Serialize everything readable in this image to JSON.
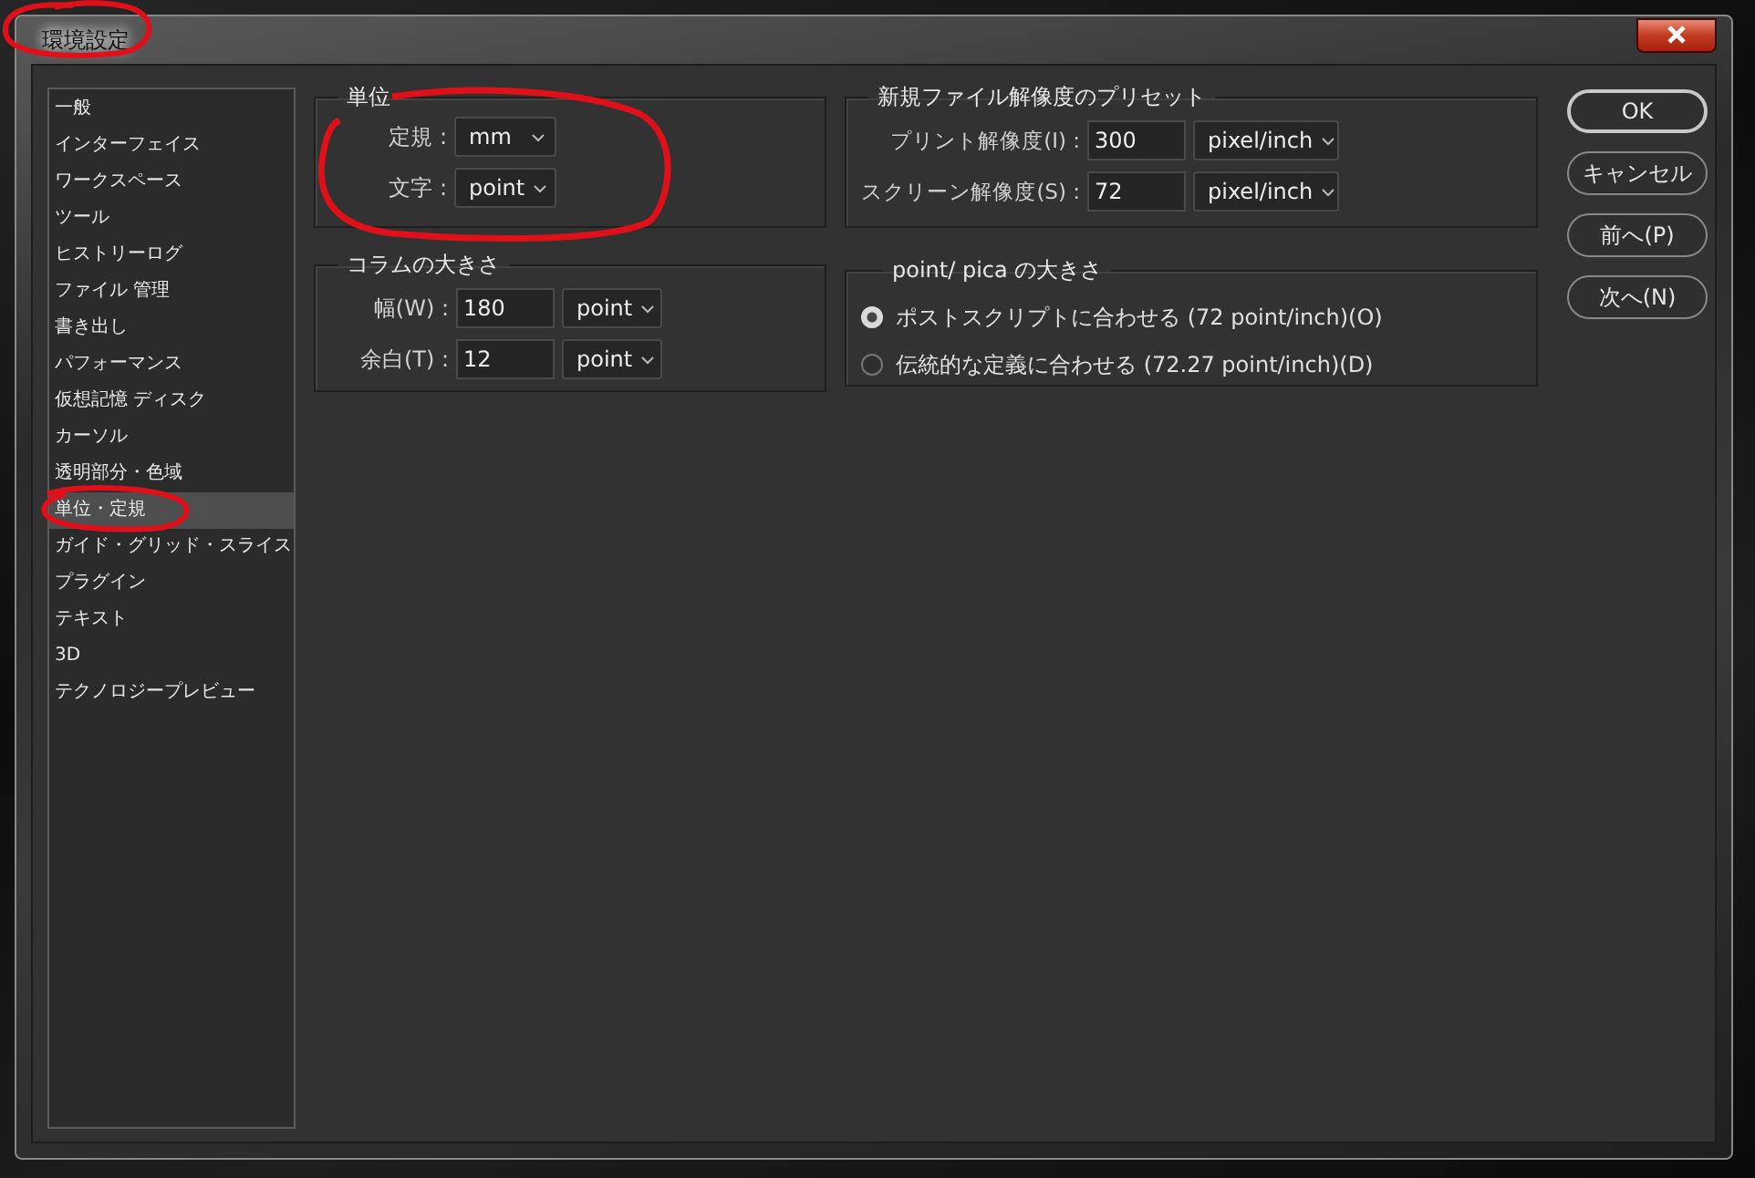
{
  "window": {
    "title": "環境設定"
  },
  "sidebar": {
    "items": [
      {
        "label": "一般",
        "selected": false
      },
      {
        "label": "インターフェイス",
        "selected": false
      },
      {
        "label": "ワークスペース",
        "selected": false
      },
      {
        "label": "ツール",
        "selected": false
      },
      {
        "label": "ヒストリーログ",
        "selected": false
      },
      {
        "label": "ファイル 管理",
        "selected": false
      },
      {
        "label": "書き出し",
        "selected": false
      },
      {
        "label": "パフォーマンス",
        "selected": false
      },
      {
        "label": "仮想記憶 ディスク",
        "selected": false
      },
      {
        "label": "カーソル",
        "selected": false
      },
      {
        "label": "透明部分・色域",
        "selected": false
      },
      {
        "label": "単位・定規",
        "selected": true
      },
      {
        "label": "ガイド・グリッド・スライス",
        "selected": false
      },
      {
        "label": "プラグイン",
        "selected": false
      },
      {
        "label": "テキスト",
        "selected": false
      },
      {
        "label": "3D",
        "selected": false
      },
      {
        "label": "テクノロジープレビュー",
        "selected": false
      }
    ]
  },
  "units": {
    "title": "単位",
    "fields": [
      {
        "label": "定規 :",
        "unit": "mm"
      },
      {
        "label": "文字 :",
        "unit": "point"
      }
    ]
  },
  "column_size": {
    "title": "コラムの大きさ",
    "fields": [
      {
        "label": "幅(W) :",
        "value": "180",
        "unit": "point"
      },
      {
        "label": "余白(T) :",
        "value": "12",
        "unit": "point"
      }
    ]
  },
  "resolution_presets": {
    "title": "新規ファイル解像度のプリセット",
    "fields": [
      {
        "label": "プリント解像度(I) :",
        "value": "300",
        "unit": "pixel/inch"
      },
      {
        "label": "スクリーン解像度(S) :",
        "value": "72",
        "unit": "pixel/inch"
      }
    ]
  },
  "point_pica": {
    "title": "point/ pica の大きさ",
    "options": [
      {
        "label": "ポストスクリプトに合わせる (72 point/inch)(O)",
        "selected": true
      },
      {
        "label": "伝統的な定義に合わせる (72.27 point/inch)(D)",
        "selected": false
      }
    ]
  },
  "buttons": [
    {
      "label": "OK",
      "default": true
    },
    {
      "label": "キャンセル",
      "default": false
    },
    {
      "label": "前へ(P)",
      "default": false
    },
    {
      "label": "次へ(N)",
      "default": false
    }
  ]
}
